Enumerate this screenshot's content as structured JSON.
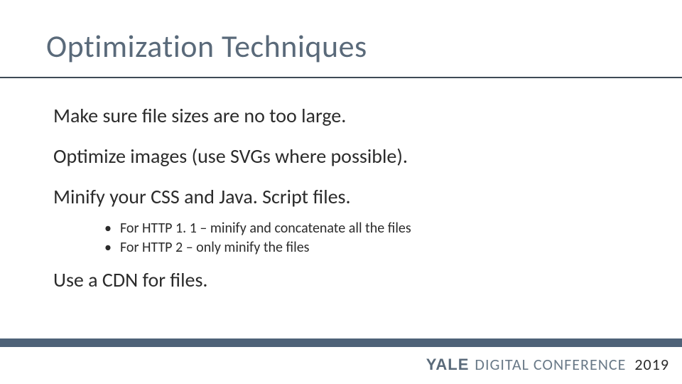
{
  "title": "Optimization Techniques",
  "points": {
    "p0": "Make sure file sizes are no too large.",
    "p1": "Optimize images (use SVGs where possible).",
    "p2": "Minify your CSS and Java. Script files.",
    "p3": "Use a CDN for files."
  },
  "subpoints": {
    "s0": "For HTTP 1. 1 – minify and concatenate all the files",
    "s1": "For HTTP 2 – only minify the files"
  },
  "footer": {
    "brand_strong": "YALE",
    "brand_rest": "DIGITAL CONFERENCE",
    "year": "2019"
  }
}
